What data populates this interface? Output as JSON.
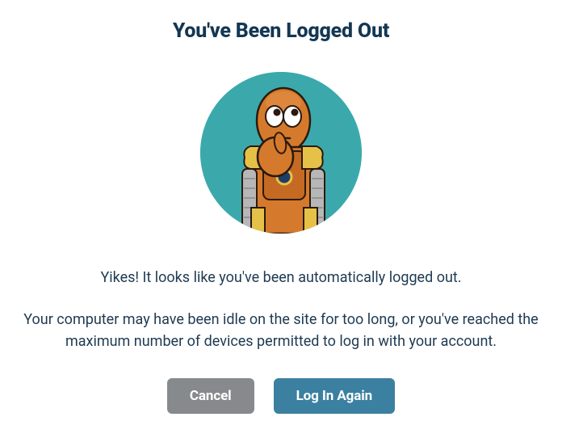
{
  "dialog": {
    "title": "You've Been Logged Out",
    "message_primary": "Yikes! It looks like you've been automatically logged out.",
    "message_secondary": "Your computer may have been idle on the site for too long, or you've reached the maximum number of devices permitted to log in with your account.",
    "cancel_label": "Cancel",
    "login_label": "Log In Again",
    "illustration_name": "robot-thinking"
  },
  "colors": {
    "primary_text": "#1e3a52",
    "cancel_button": "#868a8c",
    "primary_button": "#3b80a0",
    "circle_bg": "#3ba9ac",
    "robot_body": "#d57a2c",
    "robot_accent": "#e6c148"
  }
}
